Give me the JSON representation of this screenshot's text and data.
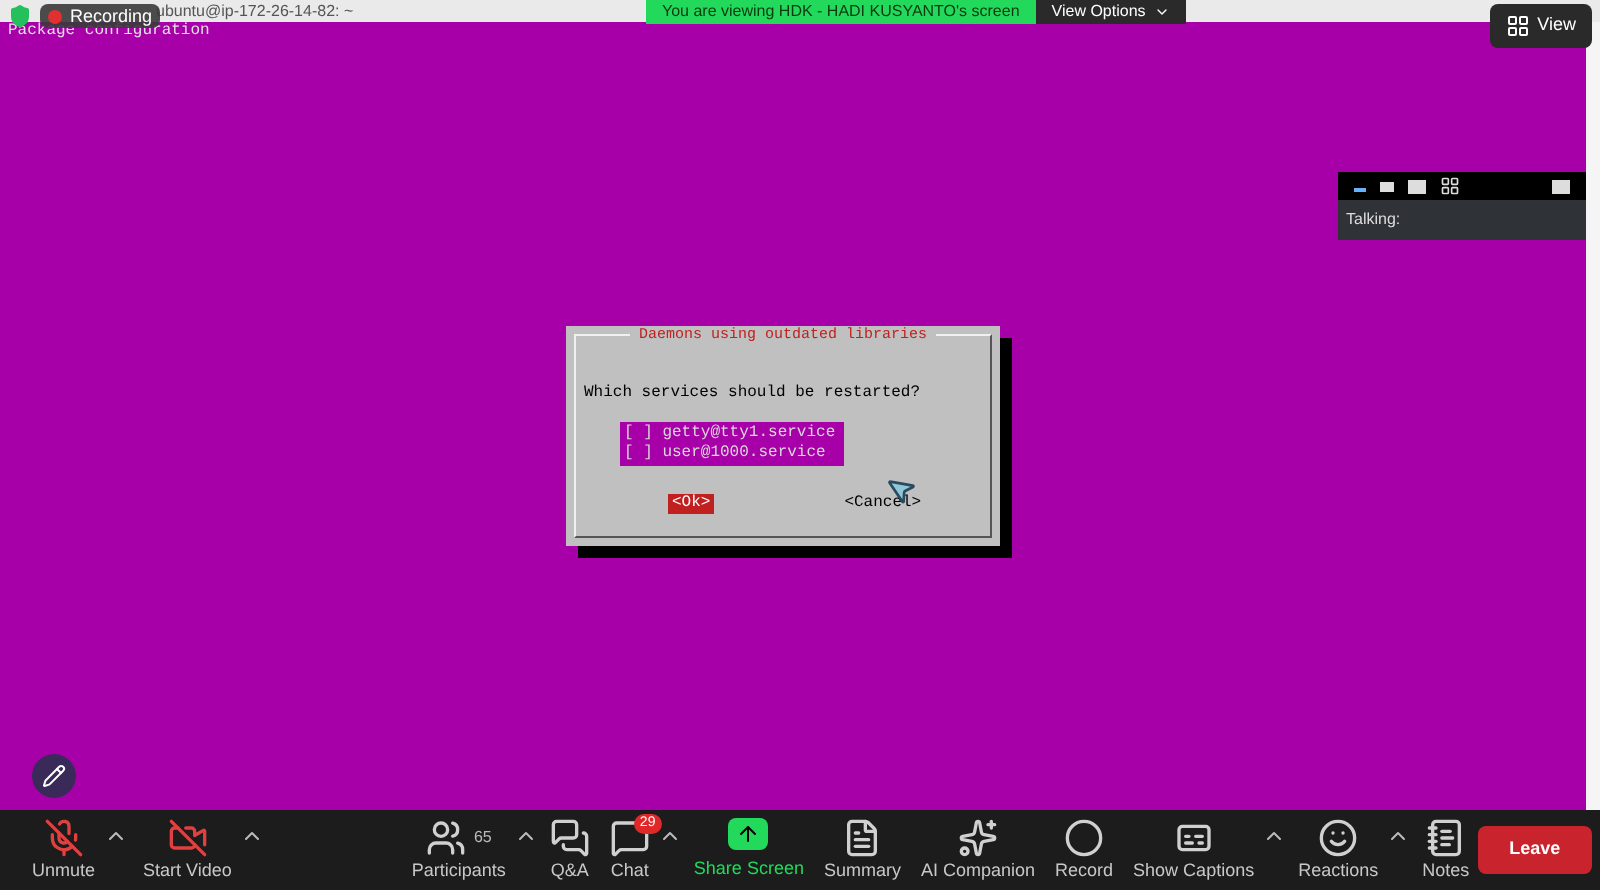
{
  "window": {
    "title": "ubuntu@ip-172-26-14-82: ~",
    "recording": "Recording"
  },
  "banner": {
    "text": "You are viewing HDK - HADI KUSYANTO's screen",
    "options": "View Options"
  },
  "view_button": "View",
  "terminal": {
    "header": "Package configuration",
    "dialog": {
      "title": "Daemons using outdated libraries",
      "question": "Which services should be restarted?",
      "options": [
        {
          "label": "[ ] getty@tty1.service"
        },
        {
          "label": "[ ] user@1000.service"
        }
      ],
      "buttons": [
        {
          "label": "<Ok>",
          "selected": true
        },
        {
          "label": "<Cancel>",
          "selected": false
        }
      ]
    }
  },
  "video_panel": {
    "talking": "Talking:"
  },
  "toolbar": {
    "left": [
      {
        "kind": "mic",
        "label": "Unmute",
        "caret": true
      },
      {
        "kind": "video",
        "label": "Start Video",
        "caret": true
      }
    ],
    "center": [
      {
        "kind": "participants",
        "label": "Participants",
        "count": "65",
        "caret": true
      },
      {
        "kind": "qa",
        "label": "Q&A",
        "caret": false
      },
      {
        "kind": "chat",
        "label": "Chat",
        "badge": "29",
        "caret": true
      },
      {
        "kind": "share",
        "label": "Share Screen",
        "caret": false
      },
      {
        "kind": "summary",
        "label": "Summary",
        "caret": false
      },
      {
        "kind": "ai",
        "label": "AI Companion",
        "caret": false
      },
      {
        "kind": "record",
        "label": "Record",
        "caret": false
      },
      {
        "kind": "captions",
        "label": "Show Captions",
        "caret": true
      },
      {
        "kind": "reactions",
        "label": "Reactions",
        "caret": true
      },
      {
        "kind": "notes",
        "label": "Notes",
        "caret": false
      }
    ],
    "leave": "Leave"
  }
}
